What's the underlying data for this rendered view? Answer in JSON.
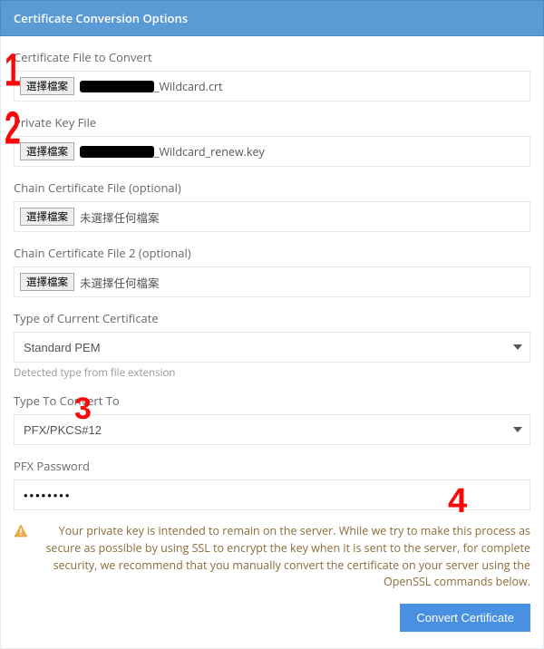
{
  "header": {
    "title": "Certificate Conversion Options"
  },
  "fields": {
    "cert_file": {
      "label": "Certificate File to Convert",
      "button": "選擇檔案",
      "filename_suffix": "_Wildcard.crt"
    },
    "priv_key": {
      "label": "Private Key File",
      "button": "選擇檔案",
      "filename_suffix": "_Wildcard_renew.key"
    },
    "chain1": {
      "label": "Chain Certificate File (optional)",
      "button": "選擇檔案",
      "no_file": "未選擇任何檔案"
    },
    "chain2": {
      "label": "Chain Certificate File 2 (optional)",
      "button": "選擇檔案",
      "no_file": "未選擇任何檔案"
    },
    "current_type": {
      "label": "Type of Current Certificate",
      "value": "Standard PEM",
      "help": "Detected type from file extension"
    },
    "convert_to": {
      "label": "Type To Convert To",
      "value": "PFX/PKCS#12"
    },
    "pfx_password": {
      "label": "PFX Password",
      "value": "••••••••"
    }
  },
  "warning": "Your private key is intended to remain on the server. While we try to make this process as secure as possible by using SSL to encrypt the key when it is sent to the server, for complete security, we recommend that you manually convert the certificate on your server using the OpenSSL commands below.",
  "actions": {
    "convert": "Convert Certificate"
  },
  "annotations": {
    "one": "1",
    "two": "2",
    "three": "3",
    "four": "4"
  }
}
